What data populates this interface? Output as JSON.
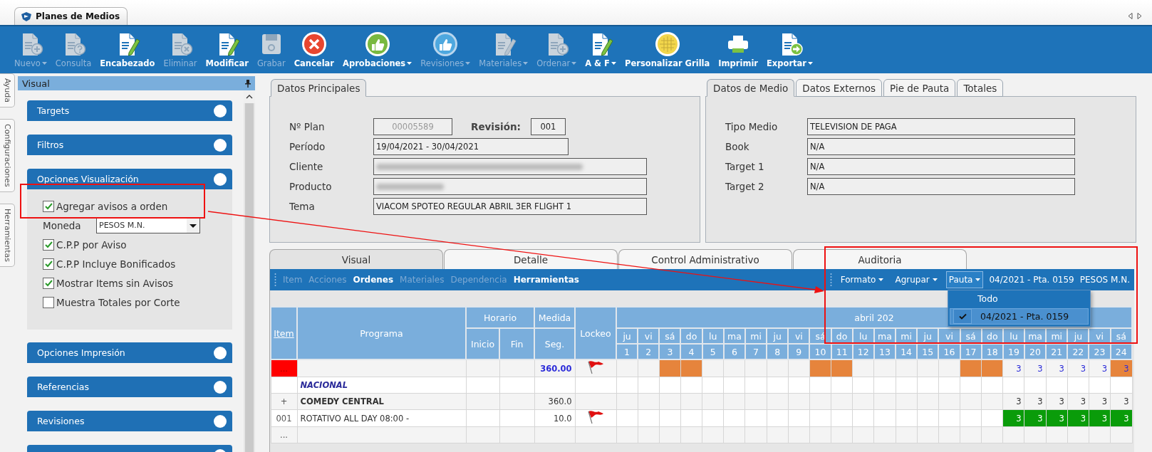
{
  "window": {
    "tab": "Planes de Medios"
  },
  "toolbar": [
    {
      "label": "Nuevo",
      "kind": "doc-plus",
      "disabled": true,
      "dropdown": true
    },
    {
      "label": "Consulta",
      "kind": "doc-question",
      "disabled": true,
      "dropdown": false
    },
    {
      "label": "Encabezado",
      "kind": "doc-pencil",
      "disabled": false,
      "dropdown": false
    },
    {
      "label": "Eliminar",
      "kind": "doc-x",
      "disabled": true,
      "dropdown": false
    },
    {
      "label": "Modificar",
      "kind": "doc-pencil",
      "disabled": false,
      "dropdown": false
    },
    {
      "label": "Grabar",
      "kind": "floppy",
      "disabled": true,
      "dropdown": false
    },
    {
      "label": "Cancelar",
      "kind": "cancel",
      "disabled": false,
      "dropdown": false
    },
    {
      "label": "Aprobaciones",
      "kind": "thumb",
      "disabled": false,
      "dropdown": true
    },
    {
      "label": "Revisiones",
      "kind": "thumb",
      "disabled": true,
      "dropdown": true
    },
    {
      "label": "Materiales",
      "kind": "doc-pencil",
      "disabled": true,
      "dropdown": true
    },
    {
      "label": "Ordenar",
      "kind": "doc-plus",
      "disabled": true,
      "dropdown": true
    },
    {
      "label": "A & F",
      "kind": "doc-pencil",
      "disabled": false,
      "dropdown": true
    },
    {
      "label": "Personalizar Grilla",
      "kind": "grid",
      "disabled": false,
      "dropdown": false
    },
    {
      "label": "Imprimir",
      "kind": "printer",
      "disabled": false,
      "dropdown": false
    },
    {
      "label": "Exportar",
      "kind": "doc-arrow",
      "disabled": false,
      "dropdown": true
    }
  ],
  "side_tabs": [
    {
      "label": "Ayuda"
    },
    {
      "label": "Configuraciones"
    },
    {
      "label": "Herramientas"
    }
  ],
  "panel": {
    "title": "Visual",
    "sections": [
      {
        "title": "Targets",
        "expanded": false
      },
      {
        "title": "Filtros",
        "expanded": false
      },
      {
        "title": "Opciones Visualización",
        "expanded": true,
        "options": [
          {
            "kind": "checkbox",
            "label": "Agregar avisos a orden",
            "checked": true
          },
          {
            "kind": "select",
            "label": "Moneda",
            "value": "PESOS M.N."
          },
          {
            "kind": "checkbox",
            "label": "C.P.P por Aviso",
            "checked": true
          },
          {
            "kind": "checkbox",
            "label": "C.P.P Incluye Bonificados",
            "checked": true
          },
          {
            "kind": "checkbox",
            "label": "Mostrar Items sin Avisos",
            "checked": true
          },
          {
            "kind": "checkbox",
            "label": "Muestra Totales por Corte",
            "checked": false
          }
        ]
      },
      {
        "title": "Opciones Impresión",
        "expanded": false
      },
      {
        "title": "Referencias",
        "expanded": false
      },
      {
        "title": "Revisiones",
        "expanded": false
      },
      {
        "expanded": false
      }
    ]
  },
  "main_tabs": [
    {
      "label": "Datos Principales",
      "selected": true
    }
  ],
  "main_fields": [
    {
      "kind": "plan",
      "label": "Nº Plan",
      "value": "00005589",
      "disabled": true,
      "revision_label": "Revisión:",
      "revision": "001"
    },
    {
      "kind": "period",
      "label": "Período",
      "value": "19/04/2021 - 30/04/2021"
    },
    {
      "kind": "redacted",
      "label": "Cliente"
    },
    {
      "kind": "redacted",
      "label": "Producto"
    },
    {
      "kind": "text",
      "label": "Tema",
      "value": "VIACOM SPOTEO REGULAR ABRIL 3ER FLIGHT 1"
    }
  ],
  "medio_tabs": [
    {
      "label": "Datos de Medio",
      "selected": true
    },
    {
      "label": "Datos Externos",
      "selected": false
    },
    {
      "label": "Pie de Pauta",
      "selected": false
    },
    {
      "label": "Totales",
      "selected": false
    }
  ],
  "medio_fields": [
    {
      "label": "Tipo Medio",
      "value": "TELEVISION DE PAGA"
    },
    {
      "label": "Book",
      "value": "N/A"
    },
    {
      "label": "Target 1",
      "value": "N/A"
    },
    {
      "label": "Target 2",
      "value": "N/A"
    }
  ],
  "view_tabs": [
    {
      "label": "Visual",
      "selected": true
    },
    {
      "label": "Detalle",
      "selected": false
    },
    {
      "label": "Control Administrativo",
      "selected": false
    },
    {
      "label": "Auditoria",
      "selected": false
    }
  ],
  "grid_menu": {
    "left": [
      {
        "label": "Item",
        "disabled": true
      },
      {
        "label": "Acciones",
        "disabled": true
      },
      {
        "label": "Ordenes",
        "disabled": false
      },
      {
        "label": "Materiales",
        "disabled": true
      },
      {
        "label": "Dependencia",
        "disabled": true
      },
      {
        "label": "Herramientas",
        "disabled": false
      }
    ],
    "right": [
      {
        "label": "Formato",
        "open": false
      },
      {
        "label": "Agrupar",
        "open": false
      },
      {
        "label": "Pauta",
        "open": true
      }
    ],
    "pauta": "04/2021 - Pta. 0159",
    "moneda": "PESOS M.N."
  },
  "pauta_menu": [
    {
      "label": "Todo",
      "selected": false
    },
    {
      "label": "04/2021 - Pta. 0159",
      "selected": true
    }
  ],
  "grid": {
    "headers": {
      "item": "Item",
      "programa": "Programa",
      "horario": "Horario",
      "inicio": "Inicio",
      "fin": "Fin",
      "medida": "Medida",
      "seg": "Seg.",
      "lockeo": "Lockeo",
      "month": "abril 202"
    },
    "days": [
      {
        "name": "ju",
        "number": "1"
      },
      {
        "name": "vi",
        "number": "2"
      },
      {
        "name": "sá",
        "number": "3"
      },
      {
        "name": "do",
        "number": "4"
      },
      {
        "name": "lu",
        "number": "5"
      },
      {
        "name": "ma",
        "number": "6"
      },
      {
        "name": "mi",
        "number": "7"
      },
      {
        "name": "ju",
        "number": "8"
      },
      {
        "name": "vi",
        "number": "9"
      },
      {
        "name": "sá",
        "number": "10"
      },
      {
        "name": "do",
        "number": "11"
      },
      {
        "name": "lu",
        "number": "12"
      },
      {
        "name": "ma",
        "number": "13"
      },
      {
        "name": "mi",
        "number": "14"
      },
      {
        "name": "ju",
        "number": "15"
      },
      {
        "name": "vi",
        "number": "16"
      },
      {
        "name": "sá",
        "number": "17"
      },
      {
        "name": "do",
        "number": "18"
      },
      {
        "name": "lu",
        "number": "19"
      },
      {
        "name": "ma",
        "number": "20"
      },
      {
        "name": "mi",
        "number": "21"
      },
      {
        "name": "ju",
        "number": "22"
      },
      {
        "name": "vi",
        "number": "23"
      },
      {
        "name": "sá",
        "number": "24"
      }
    ],
    "rows": [
      {
        "kind": "total",
        "item": "...",
        "seg": "360.00",
        "locked": true,
        "days": [
          {
            "kind": "plain"
          },
          {
            "kind": "plain"
          },
          {
            "kind": "weekend"
          },
          {
            "kind": "weekend"
          },
          {
            "kind": "plain"
          },
          {
            "kind": "plain"
          },
          {
            "kind": "plain"
          },
          {
            "kind": "plain"
          },
          {
            "kind": "plain"
          },
          {
            "kind": "weekend"
          },
          {
            "kind": "weekend"
          },
          {
            "kind": "plain"
          },
          {
            "kind": "plain"
          },
          {
            "kind": "plain"
          },
          {
            "kind": "plain"
          },
          {
            "kind": "plain"
          },
          {
            "kind": "weekend"
          },
          {
            "kind": "weekend"
          },
          {
            "kind": "count",
            "text": "3"
          },
          {
            "kind": "count",
            "text": "3"
          },
          {
            "kind": "count",
            "text": "3"
          },
          {
            "kind": "count",
            "text": "3"
          },
          {
            "kind": "count",
            "text": "3"
          },
          {
            "kind": "weekend",
            "text": "3"
          }
        ]
      },
      {
        "kind": "group",
        "programa": "NACIONAL",
        "locked": false
      },
      {
        "kind": "channel",
        "item": "+",
        "programa": "COMEDY CENTRAL",
        "seg": "360.0",
        "locked": false,
        "days": [
          {
            "kind": "plain"
          },
          {
            "kind": "plain"
          },
          {
            "kind": "plain"
          },
          {
            "kind": "plain"
          },
          {
            "kind": "plain"
          },
          {
            "kind": "plain"
          },
          {
            "kind": "plain"
          },
          {
            "kind": "plain"
          },
          {
            "kind": "plain"
          },
          {
            "kind": "plain"
          },
          {
            "kind": "plain"
          },
          {
            "kind": "plain"
          },
          {
            "kind": "plain"
          },
          {
            "kind": "plain"
          },
          {
            "kind": "plain"
          },
          {
            "kind": "plain"
          },
          {
            "kind": "plain"
          },
          {
            "kind": "plain"
          },
          {
            "kind": "count",
            "text": "3"
          },
          {
            "kind": "count",
            "text": "3"
          },
          {
            "kind": "count",
            "text": "3"
          },
          {
            "kind": "count",
            "text": "3"
          },
          {
            "kind": "count",
            "text": "3"
          },
          {
            "kind": "count",
            "text": "3"
          }
        ]
      },
      {
        "kind": "spot",
        "item": "001",
        "programa": "ROTATIVO ALL DAY 08:00 -",
        "seg": "10.0",
        "locked": true,
        "days": [
          {
            "kind": "plain"
          },
          {
            "kind": "plain"
          },
          {
            "kind": "plain"
          },
          {
            "kind": "plain"
          },
          {
            "kind": "plain"
          },
          {
            "kind": "plain"
          },
          {
            "kind": "plain"
          },
          {
            "kind": "plain"
          },
          {
            "kind": "plain"
          },
          {
            "kind": "plain"
          },
          {
            "kind": "plain"
          },
          {
            "kind": "plain"
          },
          {
            "kind": "plain"
          },
          {
            "kind": "plain"
          },
          {
            "kind": "plain"
          },
          {
            "kind": "plain"
          },
          {
            "kind": "plain"
          },
          {
            "kind": "plain"
          },
          {
            "kind": "placed",
            "text": "3"
          },
          {
            "kind": "placed",
            "text": "3"
          },
          {
            "kind": "placed",
            "text": "3"
          },
          {
            "kind": "placed",
            "text": "3"
          },
          {
            "kind": "placed",
            "text": "3"
          },
          {
            "kind": "placed",
            "text": "3"
          }
        ]
      },
      {
        "kind": "new",
        "item": "...",
        "locked": false
      }
    ]
  }
}
